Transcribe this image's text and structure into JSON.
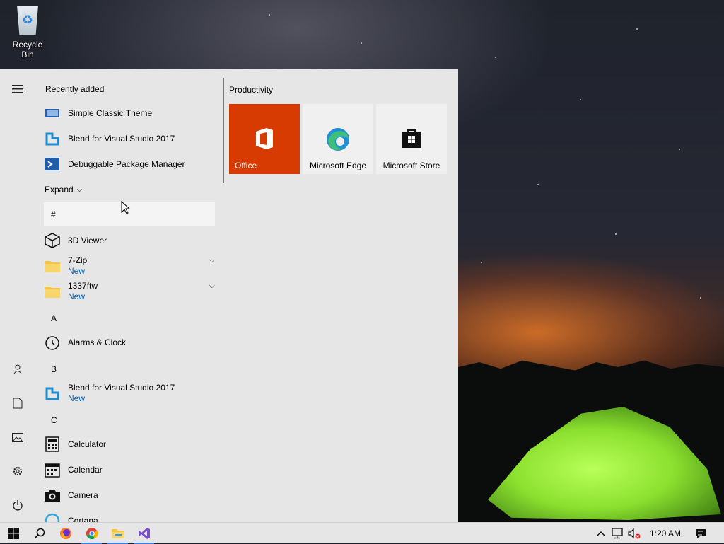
{
  "desktop": {
    "icons": [
      {
        "label": "Recycle Bin"
      }
    ]
  },
  "start_menu": {
    "left_rail": {
      "menu": "hamburger-icon",
      "user": "user-icon",
      "documents": "document-icon",
      "pictures": "pictures-icon",
      "settings": "gear-icon",
      "power": "power-icon"
    },
    "recently_added": {
      "title": "Recently added",
      "items": [
        {
          "label": "Simple Classic Theme",
          "icon": "classic-theme-icon"
        },
        {
          "label": "Blend for Visual Studio 2017",
          "icon": "blend-icon"
        },
        {
          "label": "Debuggable Package Manager",
          "icon": "powershell-icon"
        }
      ]
    },
    "expand_label": "Expand",
    "groups": {
      "hash": {
        "letter": "#",
        "items": [
          {
            "label": "3D Viewer",
            "icon": "cube-icon"
          },
          {
            "label": "7-Zip",
            "sub": "New",
            "icon": "folder-icon"
          },
          {
            "label": "1337ftw",
            "sub": "New",
            "icon": "folder-icon"
          }
        ]
      },
      "a": {
        "letter": "A",
        "items": [
          {
            "label": "Alarms & Clock",
            "icon": "clock-icon"
          }
        ]
      },
      "b": {
        "letter": "B",
        "items": [
          {
            "label": "Blend for Visual Studio 2017",
            "sub": "New",
            "icon": "blend-icon"
          }
        ]
      },
      "c": {
        "letter": "C",
        "items": [
          {
            "label": "Calculator",
            "icon": "calculator-icon"
          },
          {
            "label": "Calendar",
            "icon": "calendar-icon"
          },
          {
            "label": "Camera",
            "icon": "camera-icon"
          },
          {
            "label": "Cortana",
            "icon": "cortana-icon"
          }
        ]
      }
    },
    "tiles": {
      "group_title": "Productivity",
      "items": [
        {
          "label": "Office",
          "bg": "#d83b01",
          "fg": "#ffffff"
        },
        {
          "label": "Microsoft Edge",
          "bg": "#f0f0f0",
          "fg": "#000000"
        },
        {
          "label": "Microsoft Store",
          "bg": "#f0f0f0",
          "fg": "#000000"
        }
      ]
    }
  },
  "taskbar": {
    "buttons": [
      {
        "name": "start",
        "icon": "windows-logo-icon"
      },
      {
        "name": "search",
        "icon": "search-icon"
      },
      {
        "name": "firefox",
        "icon": "firefox-icon"
      },
      {
        "name": "chrome",
        "icon": "chrome-icon"
      },
      {
        "name": "file-explorer",
        "icon": "folder-icon"
      },
      {
        "name": "visual-studio",
        "icon": "visual-studio-icon"
      }
    ],
    "tray": {
      "show_hidden": "chevron-up-icon",
      "network": "network-icon",
      "volume": "volume-muted-icon",
      "time": "1:20 AM",
      "notifications": "action-center-icon"
    }
  },
  "colors": {
    "start_bg": "#e6e6e6",
    "accent": "#0b63b8",
    "office_tile": "#d83b01"
  }
}
